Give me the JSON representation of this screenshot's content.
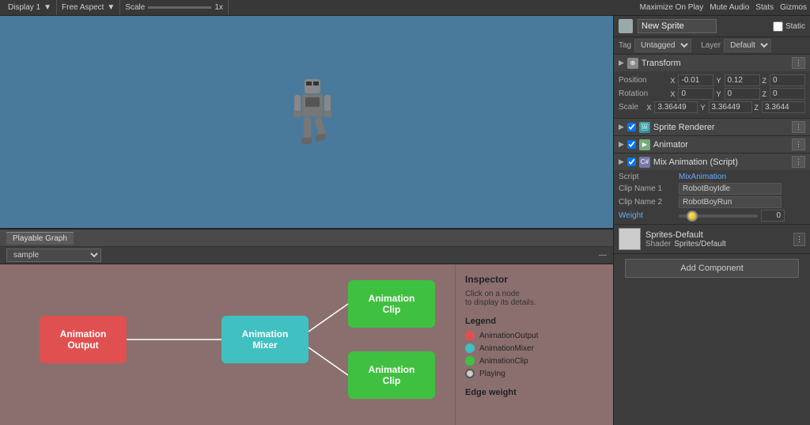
{
  "topbar": {
    "display": "Display 1",
    "aspect": "Free Aspect",
    "scale_label": "Scale",
    "scale_value": "1x",
    "maximize_on_play": "Maximize On Play",
    "mute_audio": "Mute Audio",
    "stats": "Stats",
    "gizmos": "Gizmos"
  },
  "object_header": {
    "name": "New Sprite",
    "static_label": "Static",
    "tag_label": "Tag",
    "tag_value": "Untagged",
    "layer_label": "Layer",
    "layer_value": "Default"
  },
  "transform": {
    "title": "Transform",
    "position_label": "Position",
    "pos_x": "-0.01",
    "pos_y": "0.12",
    "pos_z": "0",
    "rotation_label": "Rotation",
    "rot_x": "0",
    "rot_y": "0",
    "rot_z": "0",
    "scale_label": "Scale",
    "scale_x": "3.36449",
    "scale_y": "3.36449",
    "scale_z": "3.3644"
  },
  "sprite_renderer": {
    "title": "Sprite Renderer"
  },
  "animator": {
    "title": "Animator"
  },
  "mix_animation": {
    "title": "Mix Animation (Script)",
    "script_label": "Script",
    "script_value": "MixAnimation",
    "clip1_label": "Clip Name 1",
    "clip1_value": "RobotBoyIdle",
    "clip2_label": "Clip Name 2",
    "clip2_value": "RobotBoyRun",
    "weight_label": "Weight",
    "weight_value": "0"
  },
  "material": {
    "name": "Sprites-Default",
    "shader_label": "Shader",
    "shader_value": "Sprites/Default"
  },
  "add_component": {
    "label": "Add Component"
  },
  "playable_graph": {
    "tab_label": "Playable Graph",
    "sample_label": "sample"
  },
  "inspector_panel": {
    "title": "Inspector",
    "subtitle": "Click on a node\nto display its details.",
    "legend_title": "Legend",
    "legend_output": "AnimationOutput",
    "legend_mixer": "AnimationMixer",
    "legend_clip": "AnimationClip",
    "legend_playing": "Playing",
    "edge_weight_title": "Edge weight"
  },
  "graph_nodes": {
    "animation_output": "Animation\nOutput",
    "animation_mixer": "Animation\nMixer",
    "animation_clip_1": "Animation\nClip",
    "animation_clip_2": "Animation\nClip"
  }
}
